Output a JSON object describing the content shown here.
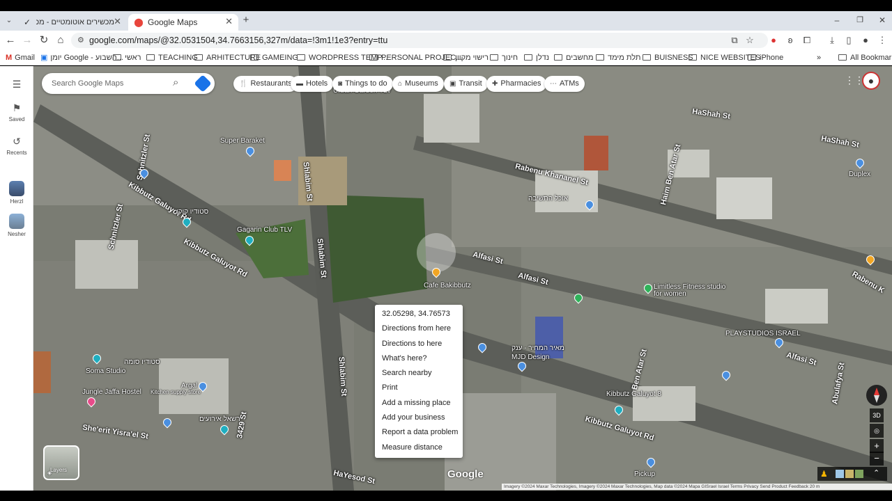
{
  "tabs": [
    {
      "title": "מכשירים אוטומטיים - מכשירים",
      "favicon": "checkmark-icon"
    },
    {
      "title": "Google Maps",
      "favicon": "maps-pin-icon"
    }
  ],
  "address_bar": {
    "url": "google.com/maps/@32.0531504,34.7663156,327m/data=!3m1!1e3?entry=ttu"
  },
  "bookmarks": [
    "Gmail",
    "יומן Google - השבוע...",
    "ראשי",
    "TEACHING",
    "ARHITECTURE",
    "GAMEING",
    "WORDPRESS TEMP...",
    "PERSONAL PROJEC...",
    "רישוי מקוון",
    "חינוך",
    "נדלן",
    "מחשבים",
    "תלת מימד",
    "BUISNESS",
    "NICE WEBSITES",
    "iPhone",
    "All Bookmarks"
  ],
  "sidebar": {
    "saved": "Saved",
    "recents": "Recents",
    "places": [
      "Herzl",
      "Nesher"
    ]
  },
  "search": {
    "placeholder": "Search Google Maps"
  },
  "chips": [
    "Restaurants",
    "Hotels",
    "Things to do",
    "Museums",
    "Transit",
    "Pharmacies",
    "ATMs"
  ],
  "context_menu": [
    "32.05298, 34.76573",
    "Directions from here",
    "Directions to here",
    "What's here?",
    "Search nearby",
    "Print",
    "Add a missing place",
    "Add your business",
    "Report a data problem",
    "Measure distance"
  ],
  "map_labels": {
    "super_baraket": "Super Baraket",
    "gagarin": "Gagarin Club TLV",
    "cafe": "Cafe Bakibbutz",
    "limitless": "Limitless Fitness studio for women",
    "playstudios": "PLAYSTUDIOS ISRAEL",
    "duplex": "Duplex",
    "soma": "Soma Studio",
    "jungle": "Jungle Jaffa Hostel",
    "argal": "Argal",
    "kitchen": "Kitchen supply store",
    "mjd": "MJD Design",
    "kibbutz_galuyot_label": "Kibbutz Galuyot 8",
    "pickup": "Pickup",
    "urban_garden": "Urban Garden TLV",
    "hebrew_1": "סטודיו קוקו",
    "hebrew_2": "סטודיו סומה",
    "hebrew_3": "מאיר המחיר - ענק",
    "hebrew_4": "אוכל התשיבה",
    "hebrew_5": "רשאל אירועים"
  },
  "roads": {
    "kibbutz_1": "Kibbutz Galuyot Rd",
    "kibbutz_2": "Kibbutz Galuyot Rd",
    "kibbutz_3": "Kibbutz Galuyot Rd",
    "shlabim_1": "Shlabim St",
    "shlabim_2": "Shlabim St",
    "shlabim_3": "Shlabim St",
    "rabenu": "Rabenu Khananel St",
    "rabenu_2": "Rabenu K",
    "alfasi_1": "Alfasi St",
    "alfasi_2": "Alfasi St",
    "alfasi_3": "Alfasi St",
    "hashah_1": "HaShah St",
    "hashah_2": "HaShah St",
    "haim_ben_atar": "Haim Ben Atar St",
    "ben_atar": "Ben Atar St",
    "abulafya": "Abulafya St",
    "sheerit": "She'erit Yisra'el St",
    "hayesod": "HaYesod St",
    "schnitzler_1": "Schnitzler St",
    "schnitzler_2": "Schnitzler St",
    "num_3429": "3429 St"
  },
  "map_controls": {
    "layers": "Layers",
    "btn_3d": "3D",
    "zoom_in": "+",
    "zoom_out": "−"
  },
  "google_logo": "Google",
  "attribution": "Imagery ©2024 Maxar Technologies, Imagery ©2024 Maxar Technologies, Map data ©2024 Mapa GISrael    Israel    Terms    Privacy    Send Product Feedback    20 m"
}
